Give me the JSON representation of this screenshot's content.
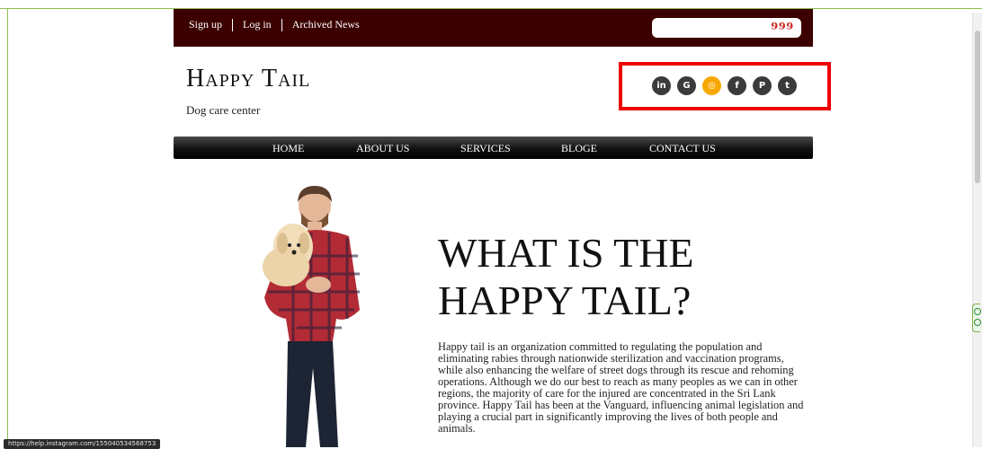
{
  "topbar": {
    "links": [
      "Sign up",
      "Log in",
      "Archived News"
    ],
    "captcha_text": "999"
  },
  "brand": {
    "title": "Happy Tail",
    "subtitle": "Dog care center"
  },
  "social": [
    {
      "name": "linkedin-icon",
      "glyph": "in",
      "active": false
    },
    {
      "name": "google-plus-icon",
      "glyph": "G",
      "active": false
    },
    {
      "name": "instagram-icon",
      "glyph": "◎",
      "active": true
    },
    {
      "name": "facebook-icon",
      "glyph": "f",
      "active": false
    },
    {
      "name": "pinterest-icon",
      "glyph": "P",
      "active": false
    },
    {
      "name": "twitter-icon",
      "glyph": "t",
      "active": false
    }
  ],
  "nav": [
    "HOME",
    "ABOUT US",
    "SERVICES",
    "BLOGE",
    "CONTACT US"
  ],
  "main": {
    "heading_line1": "WHAT IS THE",
    "heading_line2": "HAPPY TAIL?",
    "paragraph": "Happy tail is an organization committed to regulating the population and eliminating rabies through nationwide sterilization and vaccination programs, while also enhancing the welfare of street dogs through its rescue and rehoming operations. Although we do our best to reach as many peoples as we can in other regions, the majority of care for the injured are concentrated in the Sri Lank province. Happy Tail has been at the Vanguard, influencing animal legislation and playing a crucial part in significantly improving the lives of both people and animals."
  },
  "status_url": "https://help.instagram.com/155040534568753",
  "colors": {
    "topbar": "#3c0000",
    "highlight_box": "#ee0000",
    "instagram_active": "#f7a800",
    "social_icon": "#3b3b3b"
  }
}
